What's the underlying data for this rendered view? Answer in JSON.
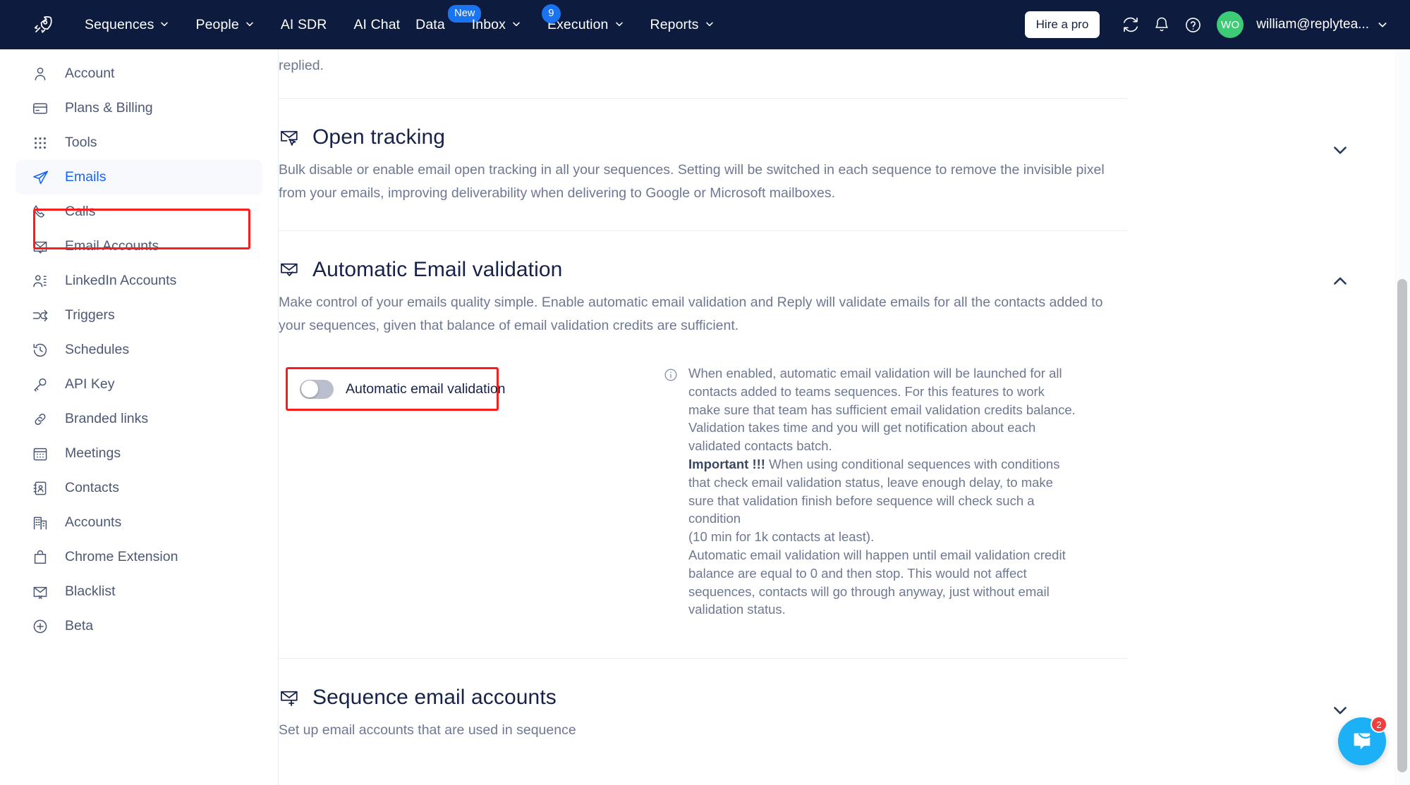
{
  "topnav": {
    "logo_icon": "rocket-icon",
    "items": [
      {
        "label": "Sequences",
        "has_chevron": true,
        "badge": null
      },
      {
        "label": "People",
        "has_chevron": true,
        "badge": null
      },
      {
        "label": "AI SDR",
        "has_chevron": false,
        "badge": null
      },
      {
        "label": "AI Chat",
        "has_chevron": false,
        "badge": null
      },
      {
        "label": "Data",
        "has_chevron": false,
        "badge": "New"
      },
      {
        "label": "Inbox",
        "has_chevron": true,
        "badge": null
      },
      {
        "label": "Execution",
        "has_chevron": true,
        "badge": "9"
      },
      {
        "label": "Reports",
        "has_chevron": true,
        "badge": null
      }
    ],
    "hire_pro_label": "Hire a pro",
    "sync_icon": "refresh-icon",
    "bell_icon": "notification-bell-icon",
    "help_icon": "help-circle-icon",
    "avatar_initials": "WO",
    "avatar_color": "#3ecb75",
    "user_email": "william@replytea...",
    "accent_color": "#1a73f0",
    "bg_color": "#0d1b3e"
  },
  "sidebar": {
    "items": [
      {
        "label": "Account",
        "icon": "user-icon",
        "active": false
      },
      {
        "label": "Plans & Billing",
        "icon": "credit-card-icon",
        "active": false
      },
      {
        "label": "Tools",
        "icon": "grid-dots-icon",
        "active": false
      },
      {
        "label": "Emails",
        "icon": "paper-plane-icon",
        "active": true
      },
      {
        "label": "Calls",
        "icon": "phone-icon",
        "active": false
      },
      {
        "label": "Email Accounts",
        "icon": "envelope-check-icon",
        "active": false
      },
      {
        "label": "LinkedIn Accounts",
        "icon": "people-icon",
        "active": false
      },
      {
        "label": "Triggers",
        "icon": "shuffle-arrows-icon",
        "active": false
      },
      {
        "label": "Schedules",
        "icon": "clock-history-icon",
        "active": false
      },
      {
        "label": "API Key",
        "icon": "key-icon",
        "active": false
      },
      {
        "label": "Branded links",
        "icon": "link-icon",
        "active": false
      },
      {
        "label": "Meetings",
        "icon": "calendar-icon",
        "active": false
      },
      {
        "label": "Contacts",
        "icon": "contact-book-icon",
        "active": false
      },
      {
        "label": "Accounts",
        "icon": "building-icon",
        "active": false
      },
      {
        "label": "Chrome Extension",
        "icon": "bag-icon",
        "active": false
      },
      {
        "label": "Blacklist",
        "icon": "envelope-x-icon",
        "active": false
      },
      {
        "label": "Beta",
        "icon": "plus-circle-icon",
        "active": false
      }
    ],
    "highlight_color": "#fb1c1c",
    "active_color": "#1763f5"
  },
  "main": {
    "top_fragment": "replied.",
    "open_tracking": {
      "title": "Open tracking",
      "icon": "envelope-cursor-icon",
      "description": "Bulk disable or enable email open tracking in all your sequences. Setting will be switched in each sequence to remove the invisible pixel from your emails, improving deliverability when delivering to Google or Microsoft mailboxes.",
      "chevron": "chevron-down-icon",
      "expanded": false
    },
    "email_validation": {
      "title": "Automatic Email validation",
      "icon": "envelope-check-icon",
      "description": "Make control of your emails quality simple. Enable automatic email validation and Reply will validate emails for all the contacts added to your sequences, given that balance of email validation credits are sufficient.",
      "chevron": "chevron-up-icon",
      "expanded": true,
      "toggle": {
        "label": "Automatic email validation",
        "state": "off",
        "highlight_color": "#fb1c1c"
      },
      "info": {
        "icon": "info-circle-icon",
        "para1": "When enabled, automatic email validation will be launched for all contacts added to teams sequences. For this features to work make sure that team has sufficient email validation credits balance.",
        "para2": "Validation takes time and you will get notification about each validated contacts batch.",
        "important_label": "Important !!!",
        "para3": " When using conditional sequences with conditions that check email validation status, leave enough delay, to make sure that validation finish before sequence will check such a condition",
        "para4": "(10 min for 1k contacts at least).",
        "para5": "Automatic email validation will happen until email validation credit balance are equal to 0 and then stop. This would not affect sequences, contacts will go through anyway, just without email validation status."
      }
    },
    "sequence_email_accounts": {
      "title": "Sequence email accounts",
      "icon": "envelope-plus-icon",
      "description": "Set up email accounts that are used in sequence",
      "chevron": "chevron-down-icon",
      "expanded": false
    }
  },
  "intercom": {
    "icon": "chat-bubble-icon",
    "badge": "2",
    "color": "#1cb0f6"
  }
}
